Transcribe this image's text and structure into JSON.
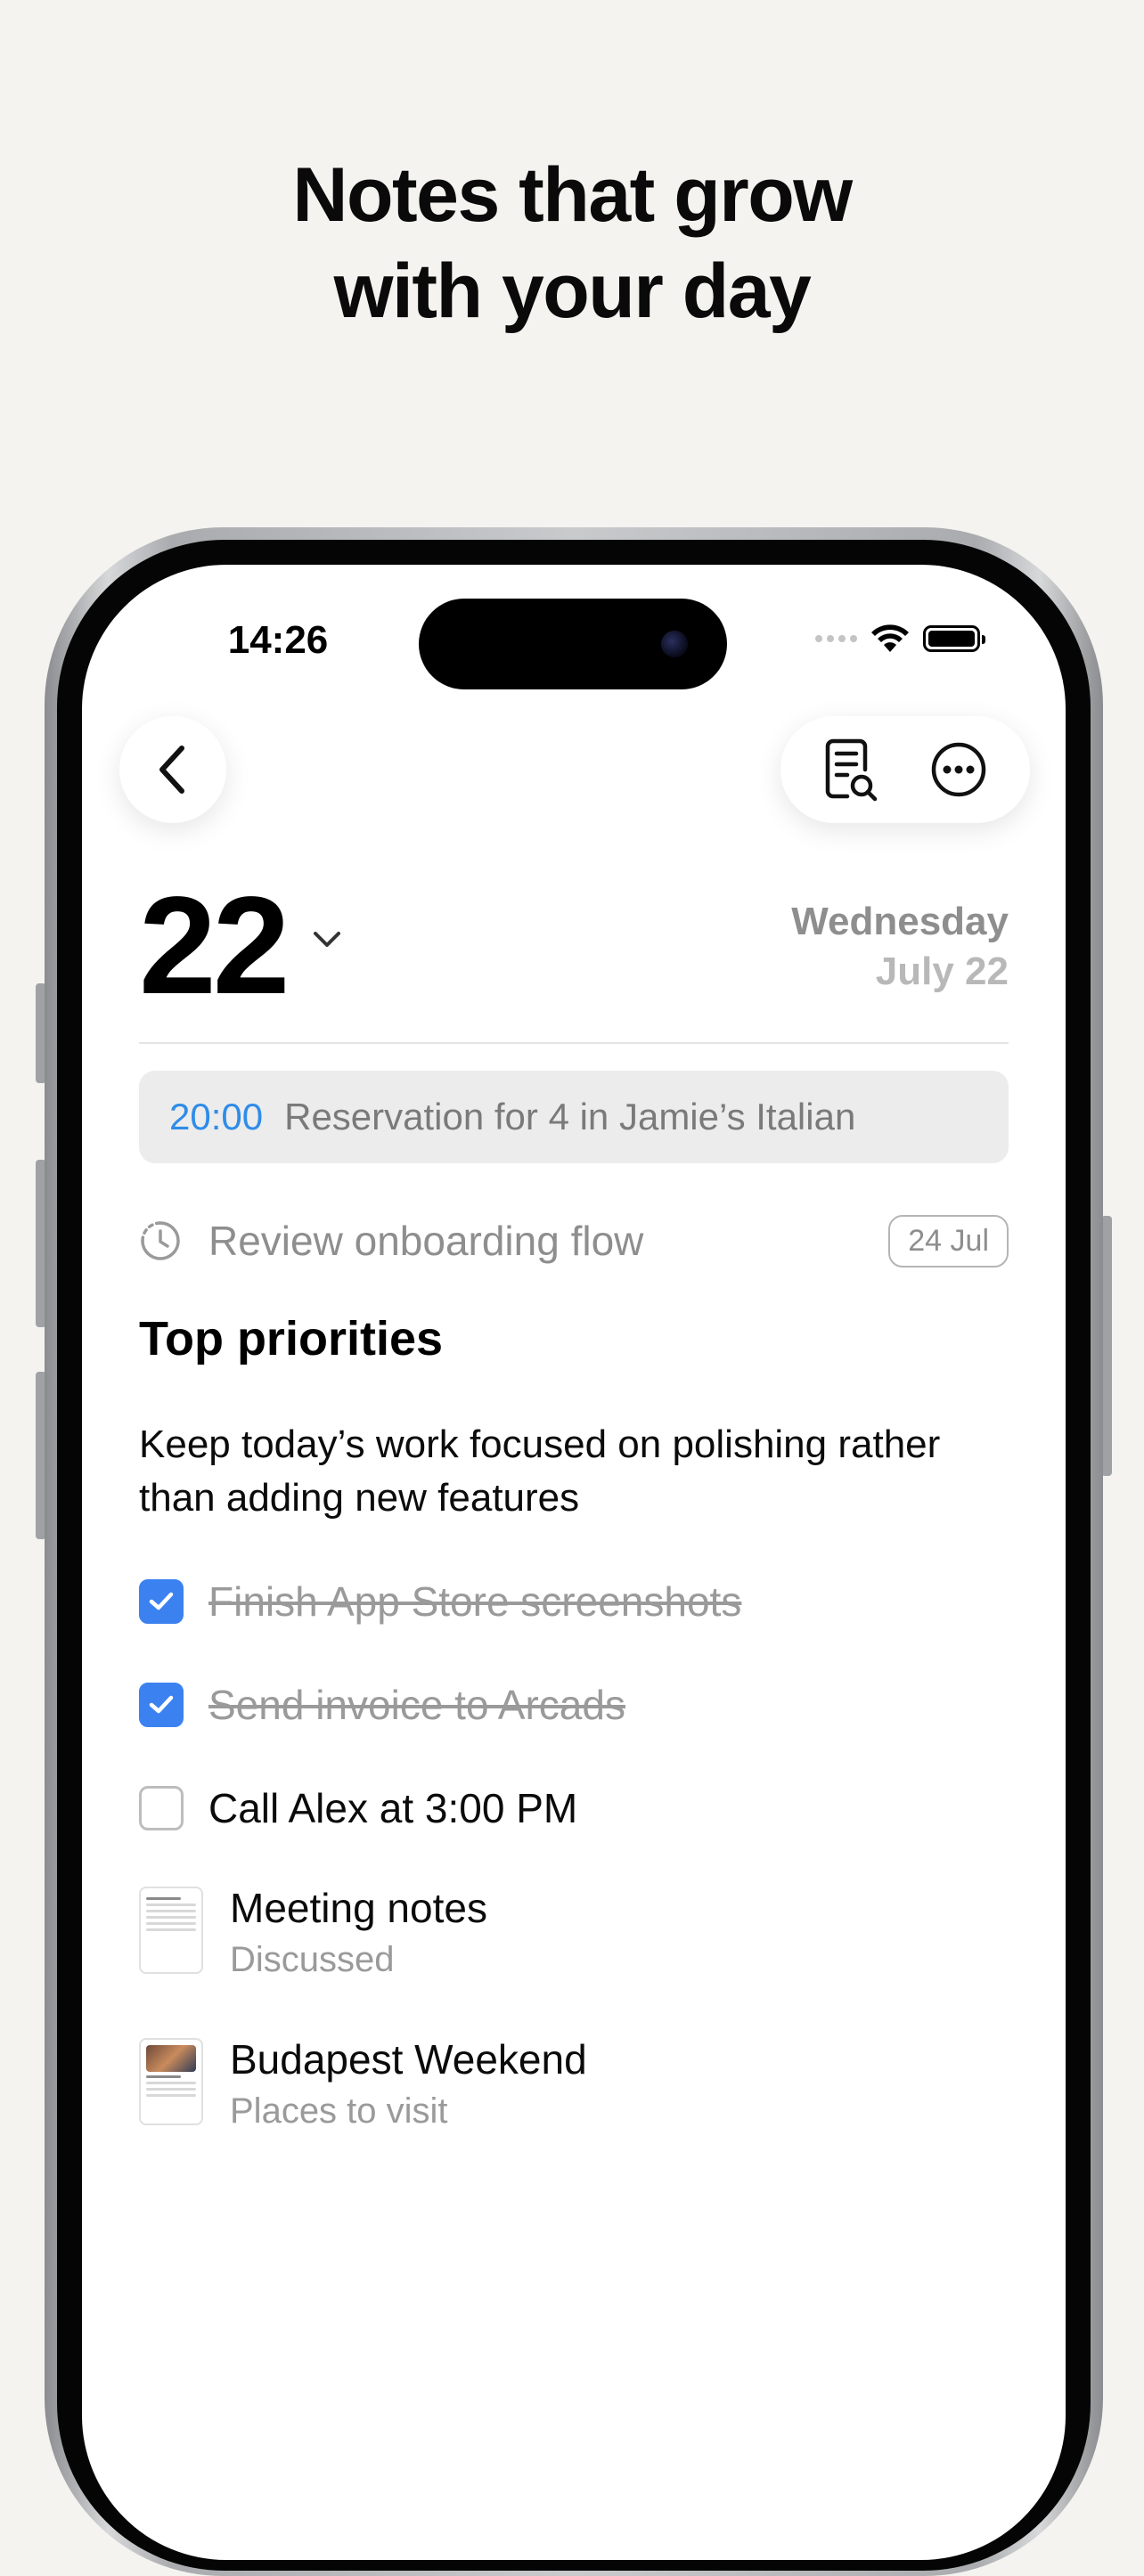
{
  "headline": [
    "Notes that grow",
    "with your day"
  ],
  "status_bar": {
    "time": "14:26"
  },
  "date_header": {
    "day": "22",
    "weekday": "Wednesday",
    "month_day": "July 22"
  },
  "event": {
    "time": "20:00",
    "title": "Reservation for 4 in Jamie’s Italian"
  },
  "reminder": {
    "text": "Review onboarding flow",
    "badge": "24 Jul"
  },
  "section": {
    "title": "Top priorities",
    "paragraph": "Keep today’s work focused on polishing rather than adding new features"
  },
  "tasks": [
    {
      "label": "Finish App Store screenshots",
      "checked": true
    },
    {
      "label": "Send invoice to Arcads",
      "checked": true
    },
    {
      "label": "Call Alex at 3:00 PM",
      "checked": false
    }
  ],
  "notes": [
    {
      "title": "Meeting notes",
      "subtitle": "Discussed"
    },
    {
      "title": "Budapest Weekend",
      "subtitle": "Places to visit"
    }
  ],
  "colors": {
    "accent": "#3b82f0",
    "event_time": "#2f8ce8",
    "background": "#f5f3f0"
  }
}
